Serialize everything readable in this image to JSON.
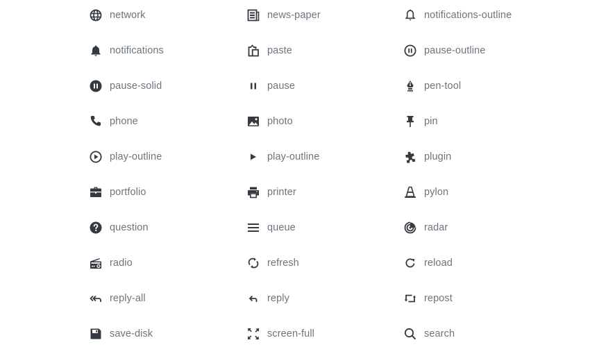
{
  "icon_color": "#343a40",
  "label_color": "#6c757d",
  "columns": [
    {
      "items": [
        {
          "label": "network",
          "icon": "network-icon"
        },
        {
          "label": "notifications",
          "icon": "bell-solid-icon"
        },
        {
          "label": "pause-solid",
          "icon": "pause-solid-icon"
        },
        {
          "label": "phone",
          "icon": "phone-icon"
        },
        {
          "label": "play-outline",
          "icon": "play-circle-outline-icon"
        },
        {
          "label": "portfolio",
          "icon": "briefcase-icon"
        },
        {
          "label": "question",
          "icon": "question-icon"
        },
        {
          "label": "radio",
          "icon": "radio-icon"
        },
        {
          "label": "reply-all",
          "icon": "reply-all-icon"
        },
        {
          "label": "save-disk",
          "icon": "floppy-disk-icon"
        }
      ]
    },
    {
      "items": [
        {
          "label": "news-paper",
          "icon": "newspaper-icon"
        },
        {
          "label": "paste",
          "icon": "paste-icon"
        },
        {
          "label": "pause",
          "icon": "pause-icon"
        },
        {
          "label": "photo",
          "icon": "photo-icon"
        },
        {
          "label": "play-outline",
          "icon": "play-icon"
        },
        {
          "label": "printer",
          "icon": "printer-icon"
        },
        {
          "label": "queue",
          "icon": "queue-icon"
        },
        {
          "label": "refresh",
          "icon": "refresh-icon"
        },
        {
          "label": "reply",
          "icon": "reply-icon"
        },
        {
          "label": "screen-full",
          "icon": "screen-full-icon"
        }
      ]
    },
    {
      "items": [
        {
          "label": "notifications-outline",
          "icon": "bell-outline-icon"
        },
        {
          "label": "pause-outline",
          "icon": "pause-outline-icon"
        },
        {
          "label": "pen-tool",
          "icon": "pen-tool-icon"
        },
        {
          "label": "pin",
          "icon": "pin-icon"
        },
        {
          "label": "plugin",
          "icon": "plugin-icon"
        },
        {
          "label": "pylon",
          "icon": "pylon-icon"
        },
        {
          "label": "radar",
          "icon": "radar-icon"
        },
        {
          "label": "reload",
          "icon": "reload-icon"
        },
        {
          "label": "repost",
          "icon": "repost-icon"
        },
        {
          "label": "search",
          "icon": "search-icon"
        }
      ]
    }
  ]
}
